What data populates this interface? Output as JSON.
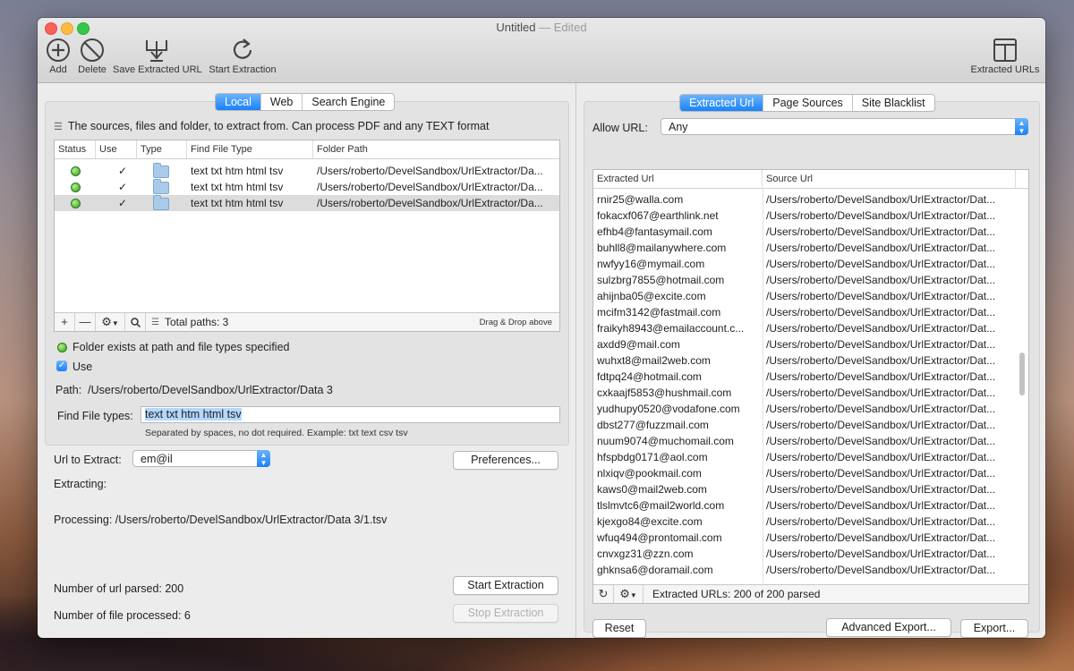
{
  "window": {
    "title": "Untitled",
    "edited": "— Edited"
  },
  "toolbar": {
    "add": "Add",
    "delete": "Delete",
    "save": "Save Extracted URL",
    "start": "Start Extraction",
    "extracted_urls": "Extracted URLs"
  },
  "left": {
    "tabs": [
      "Local",
      "Web",
      "Search Engine"
    ],
    "active_tab": "Local",
    "description": "The sources, files and folder, to extract from. Can process PDF and any TEXT format",
    "columns": [
      "Status",
      "Use",
      "Type",
      "Find File Type",
      "Folder Path"
    ],
    "rows": [
      {
        "use": "✓",
        "types": "text txt htm html tsv",
        "path": "/Users/roberto/DevelSandbox/UrlExtractor/Da..."
      },
      {
        "use": "✓",
        "types": "text txt htm html tsv",
        "path": "/Users/roberto/DevelSandbox/UrlExtractor/Da..."
      },
      {
        "use": "✓",
        "types": "text txt htm html tsv",
        "path": "/Users/roberto/DevelSandbox/UrlExtractor/Da..."
      }
    ],
    "footer": {
      "add": "+",
      "remove": "—",
      "total": "Total paths: 3",
      "drag_hint": "Drag & Drop above"
    },
    "status_text": "Folder exists at path and file types specified",
    "use_label": "Use",
    "path_label": "Path:",
    "path_value": "/Users/roberto/DevelSandbox/UrlExtractor/Data 3",
    "find_label": "Find File types:",
    "find_value": "text txt htm html tsv",
    "find_hint": "Separated by spaces, no dot required. Example: txt text csv tsv",
    "url_to_extract_label": "Url to Extract:",
    "url_to_extract_value": "em@il",
    "preferences": "Preferences...",
    "extracting_label": "Extracting:",
    "processing_text": "Processing: /Users/roberto/DevelSandbox/UrlExtractor/Data 3/1.tsv",
    "start_button": "Start Extraction",
    "stop_button": "Stop Extraction",
    "url_parsed": "Number of url parsed: 200",
    "files_processed": "Number of file processed: 6"
  },
  "right": {
    "tabs": [
      "Extracted Url",
      "Page Sources",
      "Site Blacklist"
    ],
    "active_tab": "Extracted Url",
    "allow_label": "Allow URL:",
    "allow_value": "Any",
    "columns": [
      "Extracted Url",
      "Source Url"
    ],
    "source_path": "/Users/roberto/DevelSandbox/UrlExtractor/Dat...",
    "rows": [
      "rnir25@walla.com",
      "fokacxf067@earthlink.net",
      "efhb4@fantasymail.com",
      "buhll8@mailanywhere.com",
      "nwfyy16@mymail.com",
      "sulzbrg7855@hotmail.com",
      "ahijnba05@excite.com",
      "mcifm3142@fastmail.com",
      "fraikyh8943@emailaccount.c...",
      "axdd9@mail.com",
      "wuhxt8@mail2web.com",
      "fdtpq24@hotmail.com",
      "cxkaajf5853@hushmail.com",
      "yudhupy0520@vodafone.com",
      "dbst277@fuzzmail.com",
      "nuum9074@muchomail.com",
      "hfspbdg0171@aol.com",
      "nlxiqv@pookmail.com",
      "kaws0@mail2web.com",
      "tlslmvtc6@mail2world.com",
      "kjexgo84@excite.com",
      "wfuq494@prontomail.com",
      "cnvxgz31@zzn.com",
      "ghknsa6@doramail.com"
    ],
    "footer_text": "Extracted URLs: 200 of  200 parsed",
    "reset": "Reset",
    "advanced_export": "Advanced Export...",
    "export": "Export..."
  }
}
